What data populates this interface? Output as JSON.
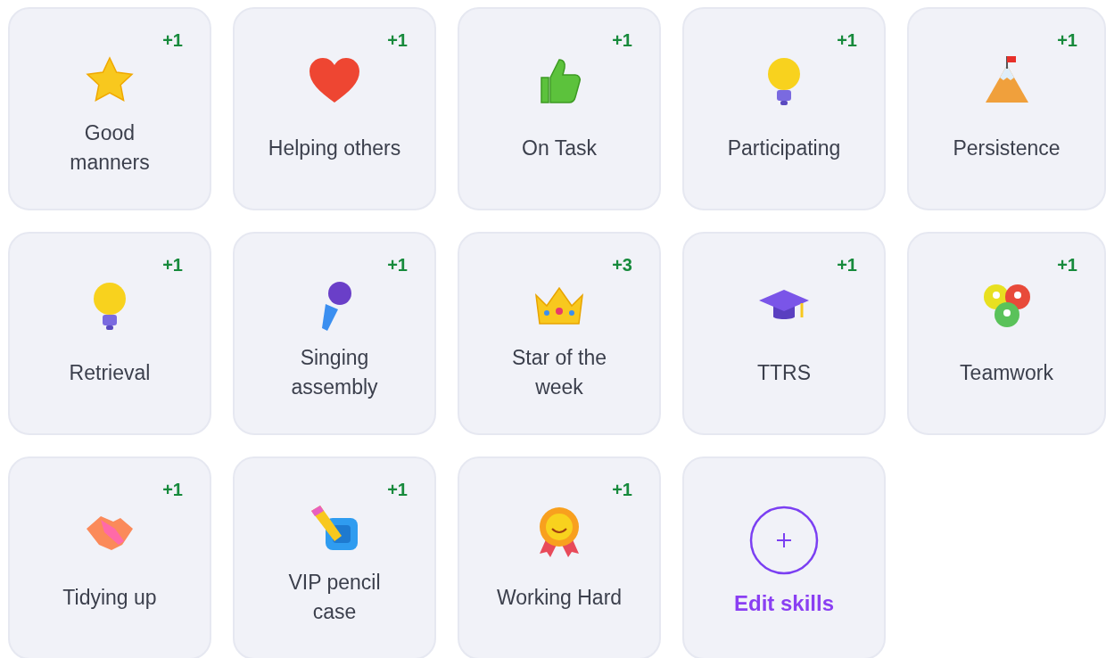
{
  "skills": [
    {
      "kind": "skill",
      "label": "Good\nmanners",
      "points": "+1"
    },
    {
      "kind": "skill",
      "label": "Helping others",
      "points": "+1"
    },
    {
      "kind": "skill",
      "label": "On Task",
      "points": "+1"
    },
    {
      "kind": "skill",
      "label": "Participating",
      "points": "+1"
    },
    {
      "kind": "skill",
      "label": "Persistence",
      "points": "+1"
    },
    {
      "kind": "skill",
      "label": "Retrieval",
      "points": "+1"
    },
    {
      "kind": "skill",
      "label": "Singing\nassembly",
      "points": "+1"
    },
    {
      "kind": "skill",
      "label": "Star of the\nweek",
      "points": "+3"
    },
    {
      "kind": "skill",
      "label": "TTRS",
      "points": "+1"
    },
    {
      "kind": "skill",
      "label": "Teamwork",
      "points": "+1"
    },
    {
      "kind": "skill",
      "label": "Tidying up",
      "points": "+1"
    },
    {
      "kind": "skill",
      "label": "VIP pencil\ncase",
      "points": "+1"
    },
    {
      "kind": "skill",
      "label": "Working Hard",
      "points": "+1"
    },
    {
      "kind": "add",
      "label": "Edit skills"
    }
  ]
}
